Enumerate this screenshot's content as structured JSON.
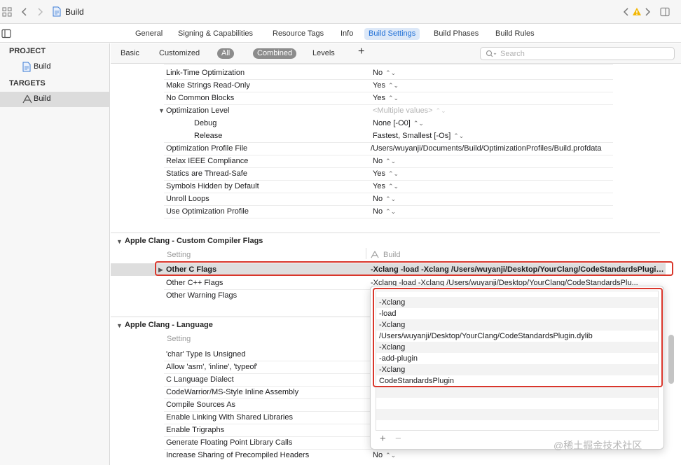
{
  "window": {
    "title": "Build"
  },
  "editor_tabs": [
    "General",
    "Signing & Capabilities",
    "Resource Tags",
    "Info",
    "Build Settings",
    "Build Phases",
    "Build Rules"
  ],
  "editor_tab_active": "Build Settings",
  "sidebar": {
    "project_header": "PROJECT",
    "project_item": "Build",
    "targets_header": "TARGETS",
    "target_item": "Build"
  },
  "filter": {
    "basic": "Basic",
    "customized": "Customized",
    "all": "All",
    "combined": "Combined",
    "levels": "Levels",
    "add": "+",
    "search_placeholder": "Search"
  },
  "optimization_rows": [
    {
      "name": "Link-Time Optimization",
      "value": "No"
    },
    {
      "name": "Make Strings Read-Only",
      "value": "Yes"
    },
    {
      "name": "No Common Blocks",
      "value": "Yes"
    },
    {
      "name": "Optimization Level",
      "value": "<Multiple values>"
    },
    {
      "name": "Debug",
      "value": "None [-O0]"
    },
    {
      "name": "Release",
      "value": "Fastest, Smallest [-Os]"
    },
    {
      "name": "Optimization Profile File",
      "value": "/Users/wuyanji/Documents/Build/OptimizationProfiles/Build.profdata"
    },
    {
      "name": "Relax IEEE Compliance",
      "value": "No"
    },
    {
      "name": "Statics are Thread-Safe",
      "value": "Yes"
    },
    {
      "name": "Symbols Hidden by Default",
      "value": "Yes"
    },
    {
      "name": "Unroll Loops",
      "value": "No"
    },
    {
      "name": "Use Optimization Profile",
      "value": "No"
    }
  ],
  "custom_flags": {
    "title": "Apple Clang - Custom Compiler Flags",
    "col_setting": "Setting",
    "col_target": "Build",
    "other_c_flags": {
      "name": "Other C Flags",
      "value": "-Xclang -load -Xclang /Users/wuyanji/Desktop/YourClang/CodeStandardsPlugin.dylib -Xclang -add-plugin -Xclang CodeStandardsPlugin"
    },
    "other_cpp_flags": {
      "name": "Other C++ Flags",
      "value": "-Xclang -load -Xclang /Users/wuyanji/Desktop/YourClang/CodeStandardsPlu..."
    },
    "other_warning_flags": {
      "name": "Other Warning Flags",
      "value": ""
    }
  },
  "language": {
    "title": "Apple Clang - Language",
    "col_setting": "Setting",
    "rows": [
      {
        "name": "'char' Type Is Unsigned",
        "value": ""
      },
      {
        "name": "Allow 'asm', 'inline', 'typeof'",
        "value": ""
      },
      {
        "name": "C Language Dialect",
        "value": ""
      },
      {
        "name": "CodeWarrior/MS-Style Inline Assembly",
        "value": ""
      },
      {
        "name": "Compile Sources As",
        "value": ""
      },
      {
        "name": "Enable Linking With Shared Libraries",
        "value": ""
      },
      {
        "name": "Enable Trigraphs",
        "value": ""
      },
      {
        "name": "Generate Floating Point Library Calls",
        "value": ""
      },
      {
        "name": "Increase Sharing of Precompiled Headers",
        "value": "No"
      }
    ]
  },
  "popup": {
    "items": [
      "-Xclang",
      "-load",
      "-Xclang",
      "/Users/wuyanji/Desktop/YourClang/CodeStandardsPlugin.dylib",
      "-Xclang",
      "-add-plugin",
      "-Xclang",
      "CodeStandardsPlugin"
    ],
    "add": "+",
    "remove": "−"
  },
  "watermark": "@稀土掘金技术社区",
  "colors": {
    "accent": "#1f6fd6",
    "highlight": "#d9362b",
    "warning": "#f2b705"
  }
}
